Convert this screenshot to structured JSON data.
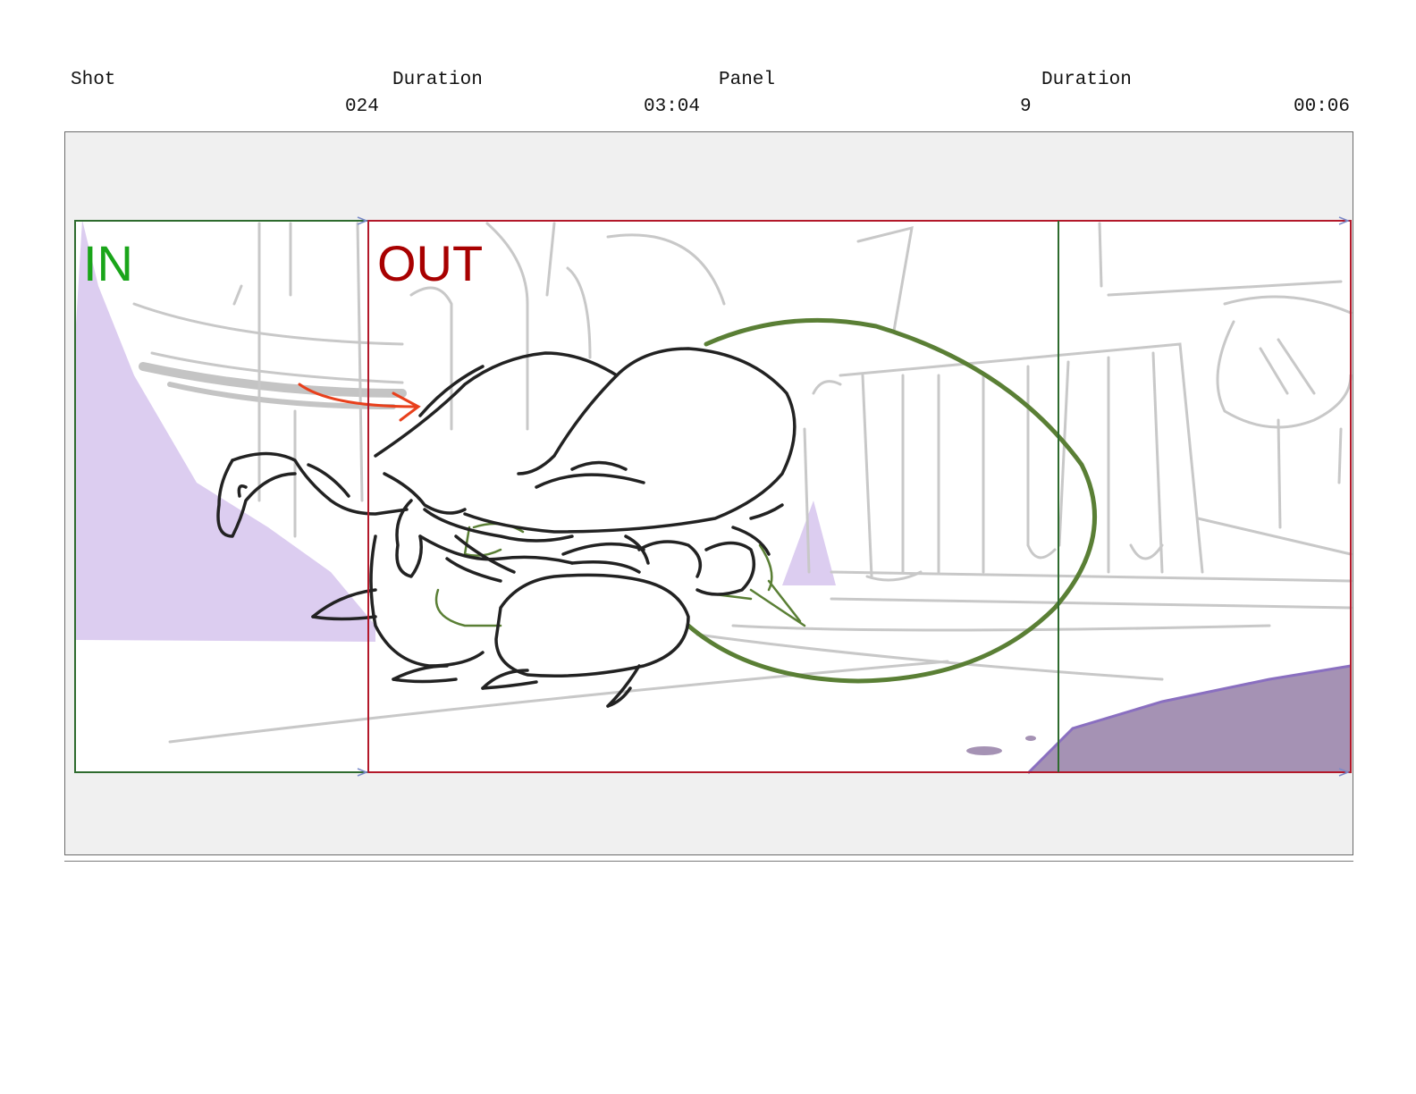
{
  "header": {
    "shot_label": "Shot",
    "shot_value": "024",
    "shot_duration_label": "Duration",
    "shot_duration_value": "03:04",
    "panel_label": "Panel",
    "panel_value": "9",
    "panel_duration_label": "Duration",
    "panel_duration_value": "00:06"
  },
  "frame": {
    "in_label": "IN",
    "out_label": "OUT"
  },
  "colors": {
    "in_green": "#1aa51a",
    "out_red": "#a80000",
    "frame_red": "#b3192a",
    "frame_green": "#2e6b2e",
    "lavender": "#dccdf0",
    "dark_purple": "#a592b4",
    "olive_green": "#5a7f35",
    "arrow_orange": "#e8401c",
    "sketch_grey": "#c8c8c8",
    "ink": "#222222"
  }
}
